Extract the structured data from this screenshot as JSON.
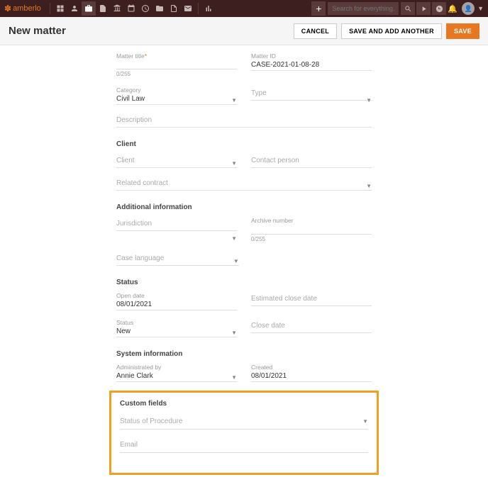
{
  "app": {
    "name": "amberlo"
  },
  "search": {
    "placeholder": "Search for everything..."
  },
  "header": {
    "title": "New matter",
    "cancel": "CANCEL",
    "save_add": "SAVE AND ADD ANOTHER",
    "save": "SAVE"
  },
  "form": {
    "matter_title_label": "Matter title",
    "matter_title_counter": "0/255",
    "matter_id_label": "Matter ID",
    "matter_id_value": "CASE-2021-01-08-28",
    "category_label": "Category",
    "category_value": "Civil Law",
    "type_placeholder": "Type",
    "description_placeholder": "Description",
    "client_section": "Client",
    "client_placeholder": "Client",
    "contact_placeholder": "Contact person",
    "related_contract_placeholder": "Related contract",
    "additional_section": "Additional information",
    "jurisdiction_placeholder": "Jurisdiction",
    "archive_label": "Archive number",
    "archive_counter": "0/255",
    "case_language_placeholder": "Case language",
    "status_section": "Status",
    "open_date_label": "Open date",
    "open_date_value": "08/01/2021",
    "est_close_placeholder": "Estimated close date",
    "status_label": "Status",
    "status_value": "New",
    "close_date_placeholder": "Close date",
    "system_section": "System information",
    "admin_label": "Administrated by",
    "admin_value": "Annie Clark",
    "created_label": "Created",
    "created_value": "08/01/2021"
  },
  "custom": {
    "section": "Custom fields",
    "status_proc": "Status of Procedure",
    "email": "Email"
  }
}
